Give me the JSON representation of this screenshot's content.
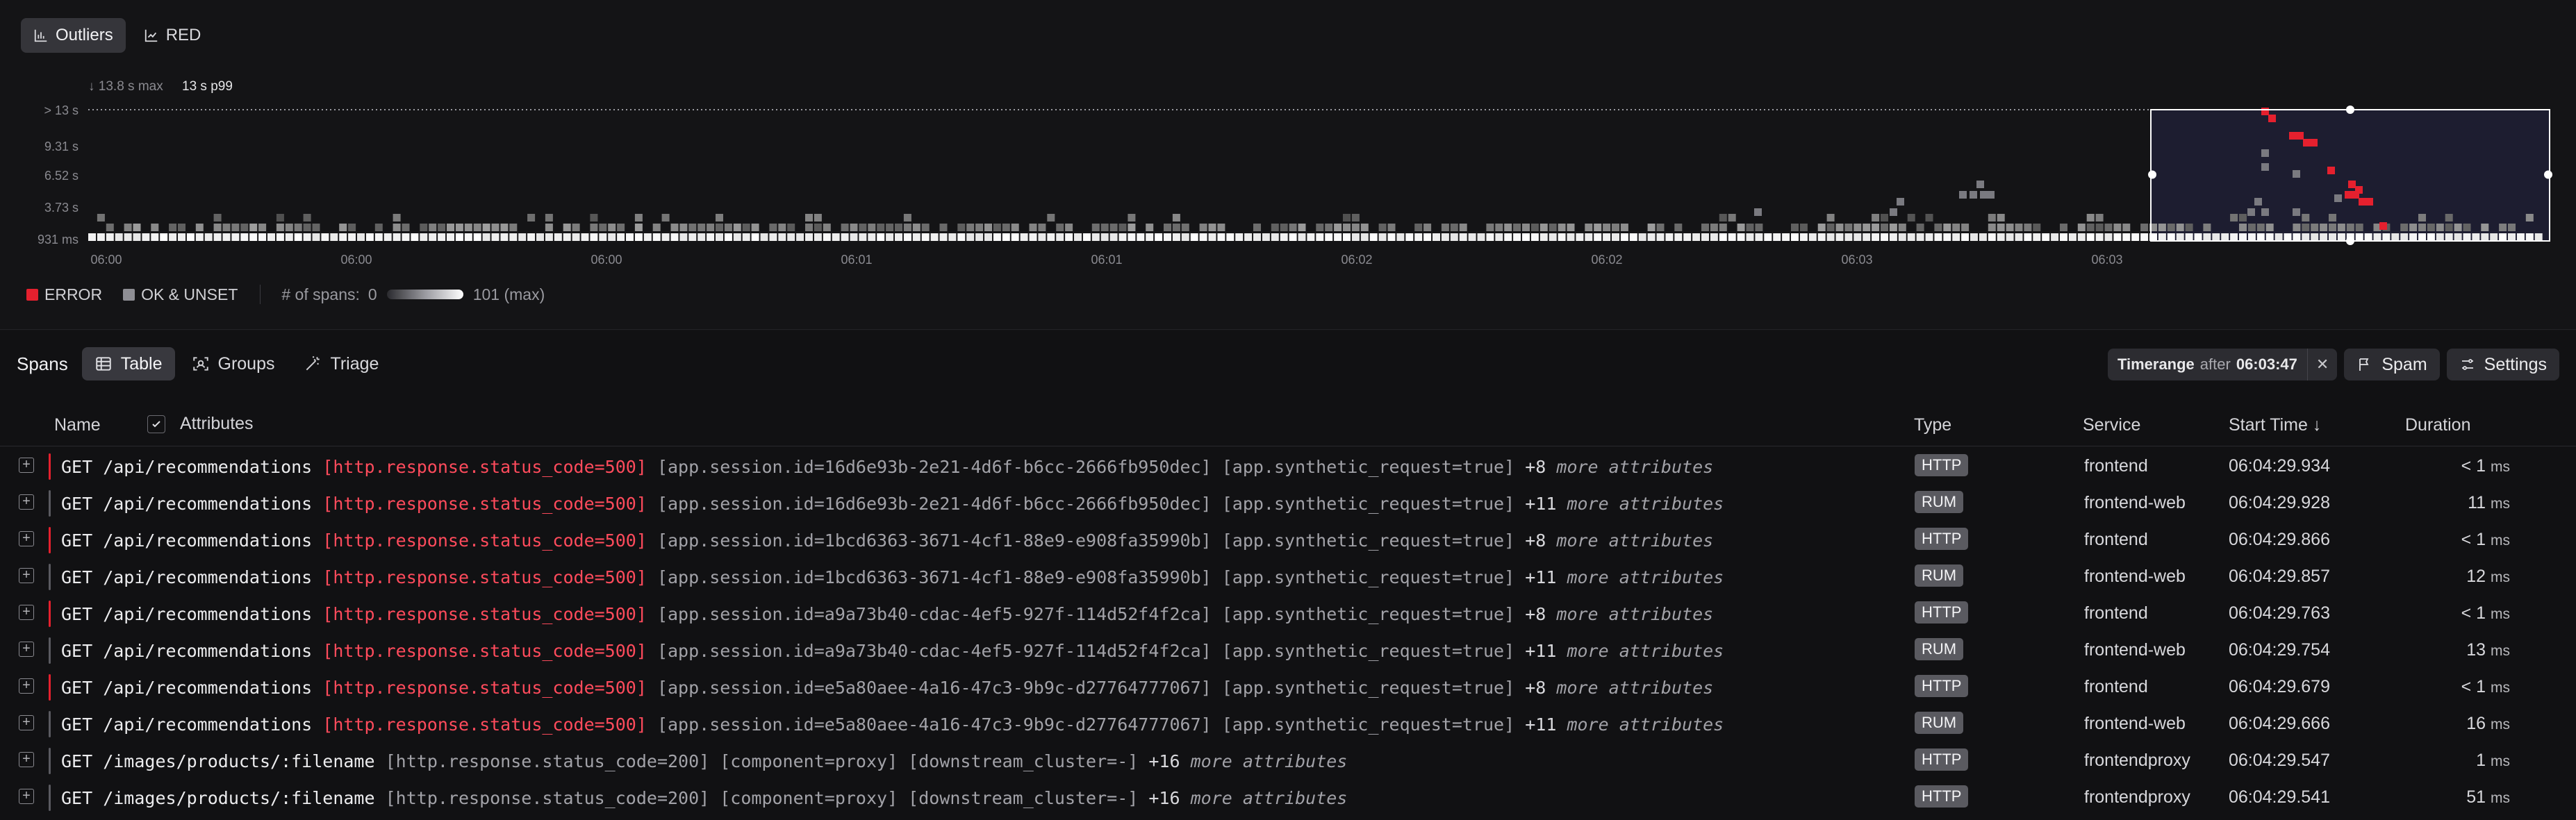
{
  "view_tabs": [
    {
      "label": "Outliers",
      "icon": "bar-chart-icon",
      "active": true
    },
    {
      "label": "RED",
      "icon": "line-chart-icon",
      "active": false
    }
  ],
  "chart": {
    "max_label": "↓ 13.8 s max",
    "p99_label": "13 s p99",
    "y_ticks": [
      "> 13 s",
      "9.31 s",
      "6.52 s",
      "3.73 s",
      "931 ms"
    ],
    "x_ticks": [
      "06:00",
      "06:00",
      "06:00",
      "06:01",
      "06:01",
      "06:02",
      "06:02",
      "06:03",
      "06:03"
    ],
    "selection": {
      "start_fraction": 0.838,
      "end_fraction": 1.0
    },
    "colors": {
      "error": "#e5202e",
      "ok": "#8e8e94",
      "selection_bg": "#1d1d30"
    }
  },
  "legend": {
    "error_label": "ERROR",
    "ok_label": "OK & UNSET",
    "spans_label": "# of spans:",
    "min": "0",
    "max": "101 (max)"
  },
  "spans_toolbar": {
    "title": "Spans",
    "tabs": [
      {
        "label": "Table",
        "icon": "table-icon",
        "active": true
      },
      {
        "label": "Groups",
        "icon": "groups-icon",
        "active": false
      },
      {
        "label": "Triage",
        "icon": "wand-icon",
        "active": false
      }
    ],
    "timerange": {
      "label": "Timerange",
      "after": "after",
      "value": "06:03:47"
    },
    "spam_label": "Spam",
    "settings_label": "Settings"
  },
  "table": {
    "headers": {
      "name": "Name",
      "attributes": "Attributes",
      "type": "Type",
      "service": "Service",
      "start_time": "Start Time ↓",
      "duration": "Duration"
    },
    "rows": [
      {
        "name": "GET /api/recommendations",
        "err": "[http.response.status_code=500]",
        "attrs": "[app.session.id=16d6e93b-2e21-4d6f-b6cc-2666fb950dec] [app.synthetic_request=true]",
        "more": "+8",
        "more_text": "more attributes",
        "type": "HTTP",
        "service": "frontend",
        "start": "06:04:29.934",
        "dur_prefix": "< 1",
        "dur_unit": "ms",
        "status": "error"
      },
      {
        "name": "GET /api/recommendations",
        "err": "[http.response.status_code=500]",
        "attrs": "[app.session.id=16d6e93b-2e21-4d6f-b6cc-2666fb950dec] [app.synthetic_request=true]",
        "more": "+11",
        "more_text": "more attributes",
        "type": "RUM",
        "service": "frontend-web",
        "start": "06:04:29.928",
        "dur_prefix": "11",
        "dur_unit": "ms",
        "status": "ok"
      },
      {
        "name": "GET /api/recommendations",
        "err": "[http.response.status_code=500]",
        "attrs": "[app.session.id=1bcd6363-3671-4cf1-88e9-e908fa35990b] [app.synthetic_request=true]",
        "more": "+8",
        "more_text": "more attributes",
        "type": "HTTP",
        "service": "frontend",
        "start": "06:04:29.866",
        "dur_prefix": "< 1",
        "dur_unit": "ms",
        "status": "error"
      },
      {
        "name": "GET /api/recommendations",
        "err": "[http.response.status_code=500]",
        "attrs": "[app.session.id=1bcd6363-3671-4cf1-88e9-e908fa35990b] [app.synthetic_request=true]",
        "more": "+11",
        "more_text": "more attributes",
        "type": "RUM",
        "service": "frontend-web",
        "start": "06:04:29.857",
        "dur_prefix": "12",
        "dur_unit": "ms",
        "status": "ok"
      },
      {
        "name": "GET /api/recommendations",
        "err": "[http.response.status_code=500]",
        "attrs": "[app.session.id=a9a73b40-cdac-4ef5-927f-114d52f4f2ca] [app.synthetic_request=true]",
        "more": "+8",
        "more_text": "more attributes",
        "type": "HTTP",
        "service": "frontend",
        "start": "06:04:29.763",
        "dur_prefix": "< 1",
        "dur_unit": "ms",
        "status": "error"
      },
      {
        "name": "GET /api/recommendations",
        "err": "[http.response.status_code=500]",
        "attrs": "[app.session.id=a9a73b40-cdac-4ef5-927f-114d52f4f2ca] [app.synthetic_request=true]",
        "more": "+11",
        "more_text": "more attributes",
        "type": "RUM",
        "service": "frontend-web",
        "start": "06:04:29.754",
        "dur_prefix": "13",
        "dur_unit": "ms",
        "status": "ok"
      },
      {
        "name": "GET /api/recommendations",
        "err": "[http.response.status_code=500]",
        "attrs": "[app.session.id=e5a80aee-4a16-47c3-9b9c-d27764777067] [app.synthetic_request=true]",
        "more": "+8",
        "more_text": "more attributes",
        "type": "HTTP",
        "service": "frontend",
        "start": "06:04:29.679",
        "dur_prefix": "< 1",
        "dur_unit": "ms",
        "status": "error"
      },
      {
        "name": "GET /api/recommendations",
        "err": "[http.response.status_code=500]",
        "attrs": "[app.session.id=e5a80aee-4a16-47c3-9b9c-d27764777067] [app.synthetic_request=true]",
        "more": "+11",
        "more_text": "more attributes",
        "type": "RUM",
        "service": "frontend-web",
        "start": "06:04:29.666",
        "dur_prefix": "16",
        "dur_unit": "ms",
        "status": "ok"
      },
      {
        "name": "GET /images/products/:filename",
        "err": "",
        "attrs": "[http.response.status_code=200] [component=proxy] [downstream_cluster=-]",
        "more": "+16",
        "more_text": "more attributes",
        "type": "HTTP",
        "service": "frontendproxy",
        "start": "06:04:29.547",
        "dur_prefix": "1",
        "dur_unit": "ms",
        "status": "ok"
      },
      {
        "name": "GET /images/products/:filename",
        "err": "",
        "attrs": "[http.response.status_code=200] [component=proxy] [downstream_cluster=-]",
        "more": "+16",
        "more_text": "more attributes",
        "type": "HTTP",
        "service": "frontendproxy",
        "start": "06:04:29.541",
        "dur_prefix": "51",
        "dur_unit": "ms",
        "status": "ok"
      }
    ]
  }
}
